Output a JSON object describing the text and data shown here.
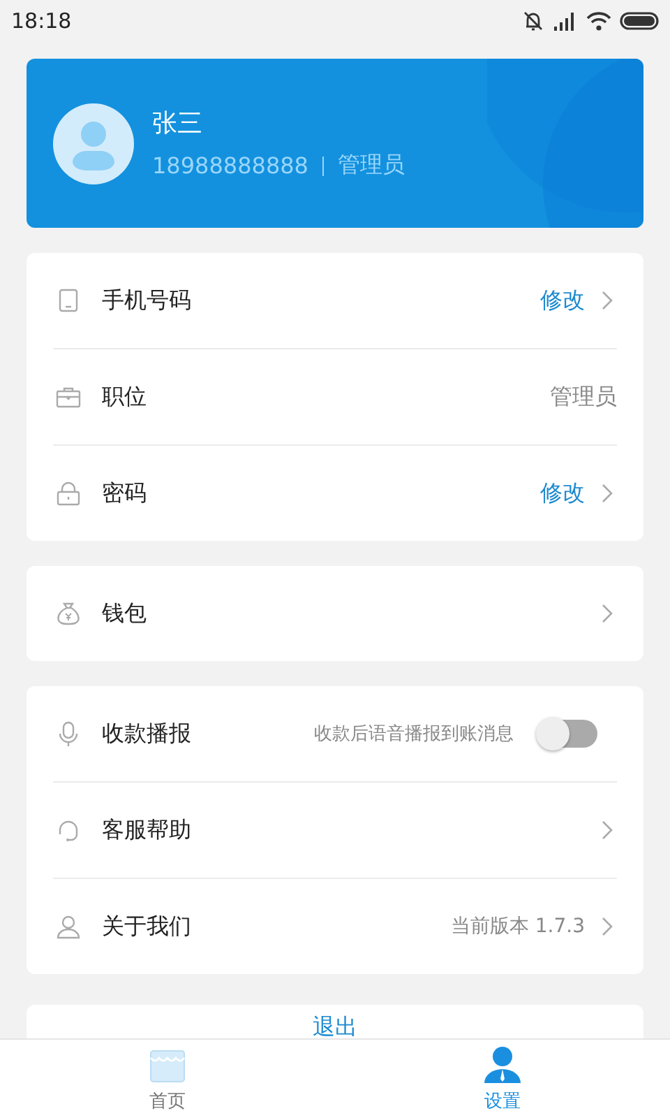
{
  "status_bar": {
    "time": "18:18"
  },
  "profile": {
    "name": "张三",
    "phone": "18988888888",
    "role": "管理员"
  },
  "groups": [
    {
      "items": [
        {
          "kind": "action",
          "label": "手机号码",
          "value": "修改"
        },
        {
          "kind": "info",
          "label": "职位",
          "value": "管理员"
        },
        {
          "kind": "action",
          "label": "密码",
          "value": "修改"
        }
      ]
    },
    {
      "items": [
        {
          "kind": "nav",
          "label": "钱包"
        }
      ]
    },
    {
      "items": [
        {
          "kind": "toggle",
          "label": "收款播报",
          "value": "收款后语音播报到账消息",
          "on": false
        },
        {
          "kind": "nav",
          "label": "客服帮助"
        },
        {
          "kind": "nav",
          "label": "关于我们",
          "value": "当前版本 1.7.3"
        }
      ]
    }
  ],
  "logout": {
    "label": "退出"
  },
  "tabs": [
    {
      "label": "首页",
      "selected": false
    },
    {
      "label": "设置",
      "selected": true
    }
  ]
}
